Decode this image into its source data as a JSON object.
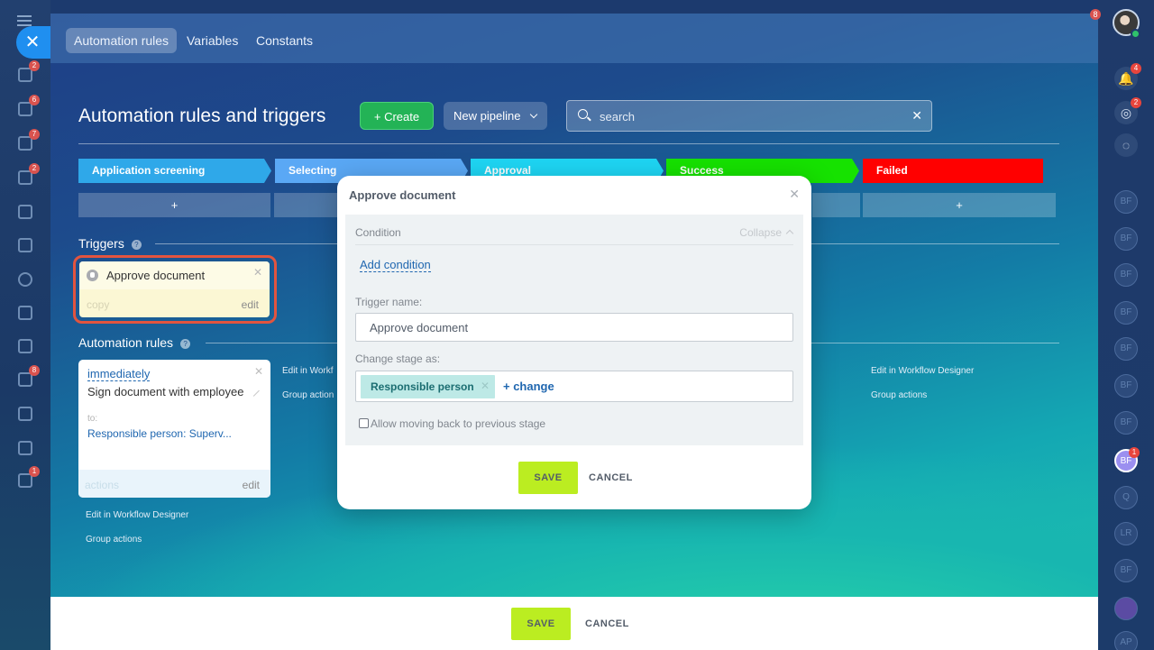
{
  "left_rail": {
    "close_label": "✕",
    "icons": [
      {
        "name": "pipelines-icon",
        "badge": "2"
      },
      {
        "name": "tasks-icon",
        "badge": "6"
      },
      {
        "name": "messenger-icon",
        "badge": "7"
      },
      {
        "name": "funnel-icon",
        "badge": "2"
      },
      {
        "name": "calendar-icon",
        "badge": ""
      },
      {
        "name": "drive-icon",
        "badge": ""
      },
      {
        "name": "target-icon",
        "badge": ""
      },
      {
        "name": "cart-icon",
        "badge": ""
      },
      {
        "name": "contact-center-icon",
        "badge": ""
      },
      {
        "name": "documents-icon",
        "badge": "8"
      },
      {
        "name": "sign-icon",
        "badge": ""
      },
      {
        "name": "analytics-icon",
        "badge": ""
      },
      {
        "name": "inbox-icon",
        "badge": "1"
      }
    ]
  },
  "right_rail": {
    "top_badge": "8",
    "icons": [
      {
        "name": "notifications-icon",
        "badge": "4"
      },
      {
        "name": "activity-icon",
        "badge": "2"
      },
      {
        "name": "chat-icon",
        "badge": ""
      }
    ],
    "avatars": [
      "BF",
      "BF",
      "BF",
      "BF",
      "BF",
      "BF",
      "BF",
      "BF",
      "Q",
      "LR",
      "BF",
      "",
      "AP"
    ],
    "active_avatar_badge": "1"
  },
  "tabs": [
    {
      "label": "Automation rules",
      "active": true
    },
    {
      "label": "Variables",
      "active": false
    },
    {
      "label": "Constants",
      "active": false
    }
  ],
  "header": {
    "title": "Automation rules and triggers",
    "create_label": "+ Create",
    "pipeline_label": "New pipeline",
    "search_placeholder": "search"
  },
  "stages": [
    {
      "name": "Application screening",
      "color": "#2fa8e9"
    },
    {
      "name": "Selecting",
      "color": "#5aa8f5"
    },
    {
      "name": "Approval",
      "color": "#1ed6f4"
    },
    {
      "name": "Success",
      "color": "#16e200"
    },
    {
      "name": "Failed",
      "color": "#ff0000"
    }
  ],
  "stage_add_label": "+",
  "triggers": {
    "label": "Triggers",
    "card": {
      "name": "Approve document",
      "copy_label": "copy",
      "edit_label": "edit"
    }
  },
  "automation": {
    "label": "Automation rules",
    "card": {
      "when": "immediately",
      "name": "Sign document with employee",
      "to_label": "to:",
      "recipient": "Responsible person: Superv...",
      "actions_label": "actions",
      "edit_label": "edit"
    },
    "edit_designer": "Edit in Workflow Designer",
    "group_actions": "Group actions",
    "col2_edit": "Edit in Workf",
    "col2_group": "Group action"
  },
  "bottom_bar": {
    "save_label": "SAVE",
    "cancel_label": "CANCEL"
  },
  "popup": {
    "title": "Approve document",
    "condition_label": "Condition",
    "collapse_label": "Collapse",
    "add_condition_label": "Add condition",
    "trigger_name_label": "Trigger name:",
    "trigger_name_value": "Approve document",
    "change_stage_label": "Change stage as:",
    "chip_label": "Responsible person",
    "change_link_label": "+ change",
    "allow_back_label": "Allow moving back to previous stage",
    "save_label": "SAVE",
    "cancel_label": "CANCEL"
  }
}
